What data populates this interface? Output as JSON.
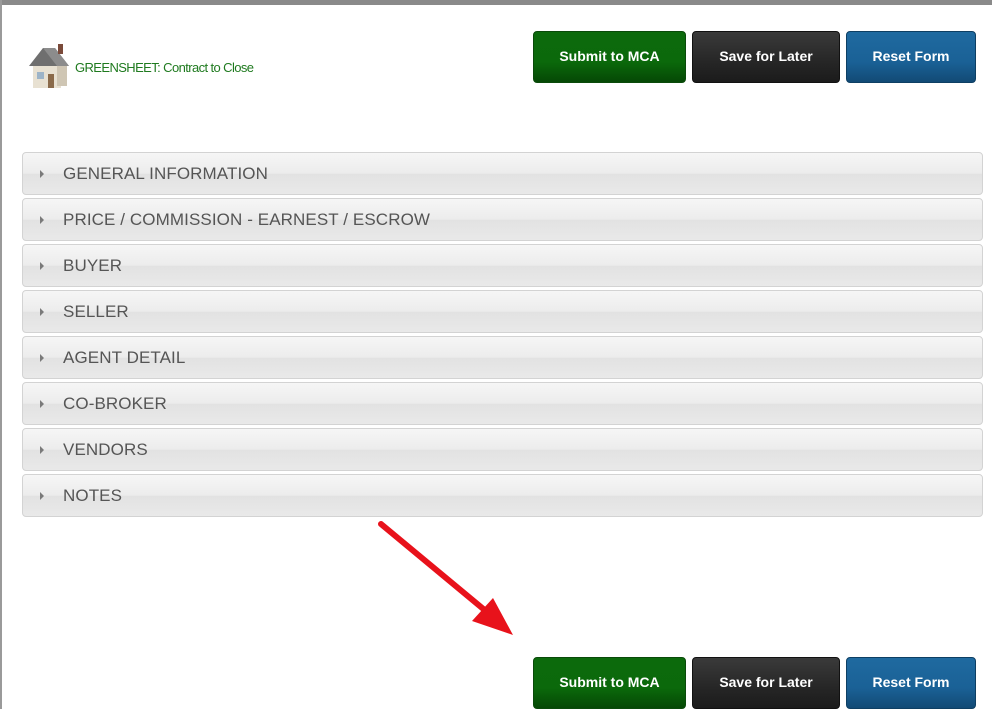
{
  "header": {
    "title": "GREENSHEET: Contract to Close",
    "logo_icon": "house-icon"
  },
  "buttons": {
    "submit": "Submit to MCA",
    "save": "Save for Later",
    "reset": "Reset Form"
  },
  "sections": [
    "GENERAL INFORMATION",
    "PRICE / COMMISSION - EARNEST / ESCROW",
    "BUYER",
    "SELLER",
    "AGENT DETAIL",
    "CO-BROKER",
    "VENDORS",
    "NOTES"
  ],
  "annotation": {
    "icon": "red-arrow-icon",
    "color": "#e8121b"
  },
  "colors": {
    "submit": "#0b690b",
    "save": "#262626",
    "reset": "#1a6196",
    "title": "#1f7a1f"
  }
}
